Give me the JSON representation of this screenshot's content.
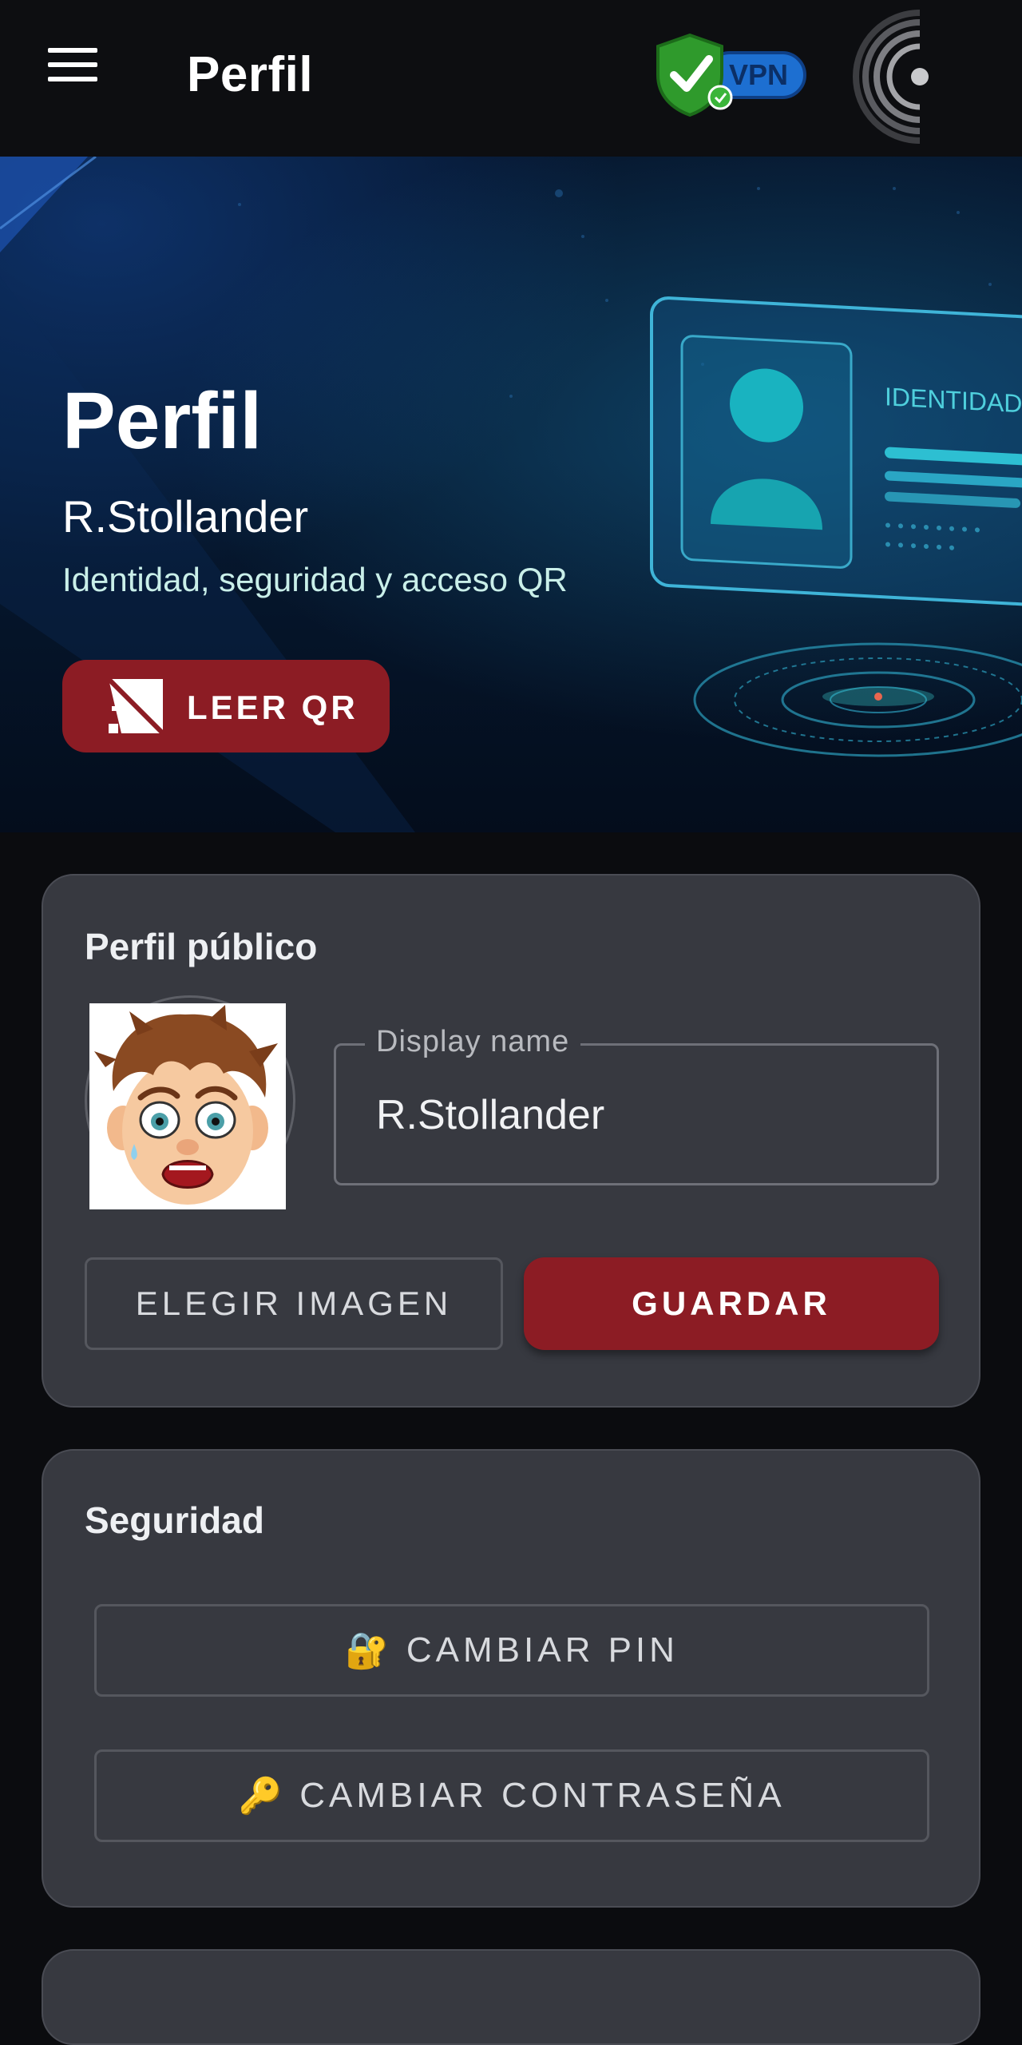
{
  "topbar": {
    "title": "Perfil",
    "vpn_label": "VPN",
    "icons": [
      "menu-icon",
      "vpn-shield-icon",
      "brand-logo"
    ]
  },
  "hero": {
    "title": "Perfil",
    "username": "R.Stollander",
    "subtitle": "Identidad, seguridad y acceso QR",
    "card_text": "IDENTIDAD D",
    "qr_button_label": "LEER QR"
  },
  "public_profile": {
    "title": "Perfil público",
    "display_name_label": "Display name",
    "display_name_value": "R.Stollander",
    "choose_image_label": "ELEGIR IMAGEN",
    "save_label": "GUARDAR"
  },
  "security": {
    "title": "Seguridad",
    "change_pin_emoji": "🔐",
    "change_pin_label": "CAMBIAR PIN",
    "change_password_emoji": "🔑",
    "change_password_label": "CAMBIAR CONTRASEÑA"
  },
  "colors": {
    "accent_red": "#8c1c24",
    "card_bg": "#373940",
    "page_bg": "#0b0c0f",
    "hero_bg": "#061a33"
  }
}
